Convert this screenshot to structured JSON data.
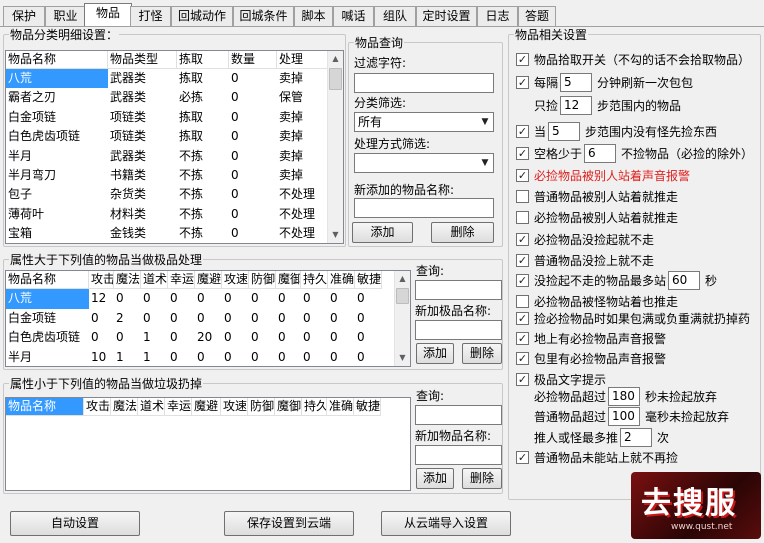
{
  "tabs": [
    "保护",
    "职业",
    "物品",
    "打怪",
    "回城动作",
    "回城条件",
    "脚本",
    "喊话",
    "组队",
    "定时设置",
    "日志",
    "答题"
  ],
  "active_tab": "物品",
  "category_group": {
    "legend": "物品分类明细设置：",
    "columns": [
      "物品名称",
      "物品类型",
      "拣取",
      "数量",
      "处理"
    ],
    "rows": [
      [
        "八荒",
        "武器类",
        "拣取",
        "0",
        "卖掉"
      ],
      [
        "霸者之刃",
        "武器类",
        "必拣",
        "0",
        "保管"
      ],
      [
        "白金项链",
        "项链类",
        "拣取",
        "0",
        "卖掉"
      ],
      [
        "白色虎齿项链",
        "项链类",
        "拣取",
        "0",
        "卖掉"
      ],
      [
        "半月",
        "武器类",
        "不拣",
        "0",
        "卖掉"
      ],
      [
        "半月弯刀",
        "书籍类",
        "不拣",
        "0",
        "卖掉"
      ],
      [
        "包子",
        "杂货类",
        "不拣",
        "0",
        "不处理"
      ],
      [
        "薄荷叶",
        "材料类",
        "不拣",
        "0",
        "不处理"
      ],
      [
        "宝箱",
        "金钱类",
        "不拣",
        "0",
        "不处理"
      ]
    ]
  },
  "query_group": {
    "legend": "物品查询",
    "filter_label": "过滤字符:",
    "filter_value": "",
    "category_label": "分类筛选:",
    "category_value": "所有",
    "handle_label": "处理方式筛选:",
    "handle_value": "",
    "new_item_label": "新添加的物品名称:",
    "new_item_value": "",
    "add_label": "添加",
    "delete_label": "删除"
  },
  "best_group": {
    "legend": "属性大于下列值的物品当做极品处理",
    "columns": [
      "物品名称",
      "攻击",
      "魔法",
      "道术",
      "幸运",
      "魔避",
      "攻速",
      "防御",
      "魔御",
      "持久",
      "准确",
      "敏捷"
    ],
    "rows": [
      [
        "八荒",
        "12",
        "0",
        "0",
        "0",
        "0",
        "0",
        "0",
        "0",
        "0",
        "0",
        "0"
      ],
      [
        "白金项链",
        "0",
        "2",
        "0",
        "0",
        "0",
        "0",
        "0",
        "0",
        "0",
        "0",
        "0"
      ],
      [
        "白色虎齿项链",
        "0",
        "0",
        "1",
        "0",
        "20",
        "0",
        "0",
        "0",
        "0",
        "0",
        "0"
      ],
      [
        "半月",
        "10",
        "1",
        "1",
        "0",
        "0",
        "0",
        "0",
        "0",
        "0",
        "0",
        "0"
      ]
    ],
    "query_label": "查询:",
    "query_value": "",
    "new_label": "新加极品名称:",
    "new_value": "",
    "add_label": "添加",
    "delete_label": "删除"
  },
  "junk_group": {
    "legend": "属性小于下列值的物品当做垃圾扔掉",
    "columns": [
      "物品名称",
      "攻击",
      "魔法",
      "道术",
      "幸运",
      "魔避",
      "攻速",
      "防御",
      "魔御",
      "持久",
      "准确",
      "敏捷"
    ],
    "query_label": "查询:",
    "query_value": "",
    "new_label": "新加物品名称:",
    "new_value": "",
    "add_label": "添加",
    "delete_label": "删除"
  },
  "settings_group": {
    "legend": "物品相关设置",
    "items": [
      {
        "checked": true,
        "text": "物品拾取开关（不勾的话不会拾取物品）"
      },
      {
        "checked": true,
        "text": "每隔",
        "value": "5",
        "suffix": "分钟刷新一次包包"
      },
      {
        "checked": null,
        "text": "只捡",
        "value": "12",
        "suffix": "步范围内的物品"
      },
      {
        "checked": true,
        "text": "当",
        "value": "5",
        "suffix": "步范围内没有怪先捡东西"
      },
      {
        "checked": true,
        "text": "空格少于",
        "value": "6",
        "suffix": "不捡物品（必捡的除外）"
      },
      {
        "checked": true,
        "text": "必捡物品被别人站着声音报警",
        "red": true
      },
      {
        "checked": false,
        "text": "普通物品被别人站着就推走"
      },
      {
        "checked": false,
        "text": "必捡物品被别人站着就推走"
      },
      {
        "checked": true,
        "text": "必捡物品没捡起就不走"
      },
      {
        "checked": true,
        "text": "普通物品没捡上就不走"
      },
      {
        "checked": true,
        "text": "没捡起不走的物品最多站",
        "value": "60",
        "suffix": "秒"
      },
      {
        "checked": false,
        "text": "必捡物品被怪物站着也推走"
      },
      {
        "checked": true,
        "text": "捡必捡物品时如果包满或负重满就扔掉药"
      },
      {
        "checked": true,
        "text": "地上有必捡物品声音报警"
      },
      {
        "checked": true,
        "text": "包里有必捡物品声音报警"
      },
      {
        "checked": true,
        "text": "极品文字提示"
      },
      {
        "checked": null,
        "text": "必捡物品超过",
        "value": "180",
        "suffix": "秒未捡起放弃"
      },
      {
        "checked": null,
        "text": "普通物品超过",
        "value": "100",
        "suffix": "毫秒未捡起放弃"
      },
      {
        "checked": null,
        "text": "推人或怪最多推",
        "value": "2",
        "suffix": "次"
      },
      {
        "checked": true,
        "text": "普通物品未能站上就不再捡"
      }
    ]
  },
  "bottom_buttons": {
    "auto": "自动设置",
    "save_cloud": "保存设置到云端",
    "import_cloud": "从云端导入设置"
  },
  "watermark": {
    "text": "去搜服",
    "url": "www.qust.net"
  },
  "colors": {
    "selection": "#3399ff",
    "warning_text": "#e02020",
    "logo_red": "#c81818"
  }
}
